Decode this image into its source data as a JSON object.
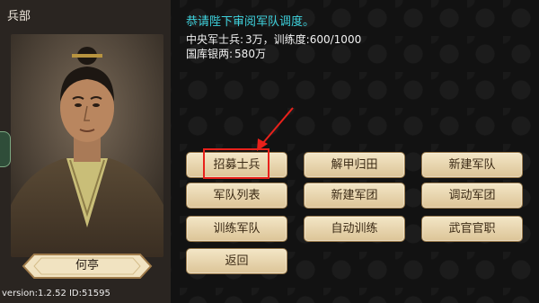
{
  "left_panel": {
    "title": "兵部",
    "official_name": "何亭",
    "version_text": "version:1.2.52   ID:51595"
  },
  "info": {
    "title": "恭请陛下审阅军队调度。",
    "line1_label": "中央军士兵:",
    "line1_value": "3万，训练度:600/1000",
    "line2_label": "国库银两:",
    "line2_value": "580万"
  },
  "buttons": {
    "recruit": "招募士兵",
    "disband": "解甲归田",
    "new_army": "新建军队",
    "army_list": "军队列表",
    "new_corps": "新建军团",
    "move_corps": "调动军团",
    "train_army": "训练军队",
    "auto_train": "自动训练",
    "officer_posts": "武官官职",
    "back": "返回"
  },
  "colors": {
    "title_cyan": "#3ed2dd",
    "highlight_red": "#e8211b",
    "button_face": "#e8d6ad"
  }
}
